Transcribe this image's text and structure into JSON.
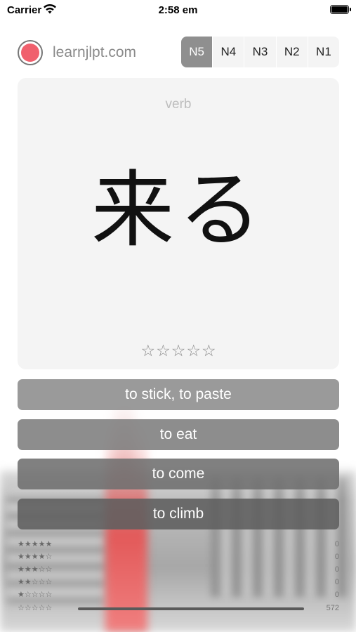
{
  "status": {
    "carrier": "Carrier",
    "time": "2:58 em"
  },
  "header": {
    "site": "learnjlpt.com",
    "levels": [
      "N5",
      "N4",
      "N3",
      "N2",
      "N1"
    ],
    "active_level": "N5"
  },
  "card": {
    "part_of_speech": "verb",
    "word": "来る",
    "rating_stars": [
      "☆",
      "☆",
      "☆",
      "☆",
      "☆"
    ],
    "rating_value": 0
  },
  "answers": [
    "to stick, to paste",
    "to eat",
    "to come",
    "to climb"
  ],
  "stats": [
    {
      "stars": "★★★★★",
      "count": "0",
      "fraction": 0
    },
    {
      "stars": "★★★★☆",
      "count": "0",
      "fraction": 0
    },
    {
      "stars": "★★★☆☆",
      "count": "0",
      "fraction": 0
    },
    {
      "stars": "★★☆☆☆",
      "count": "0",
      "fraction": 0
    },
    {
      "stars": "★☆☆☆☆",
      "count": "0",
      "fraction": 0
    },
    {
      "stars": "☆☆☆☆☆",
      "count": "572",
      "fraction": 1
    }
  ],
  "colors": {
    "accent": "#8f8f8f",
    "logo": "#f0606d",
    "card": "#f4f4f4"
  }
}
